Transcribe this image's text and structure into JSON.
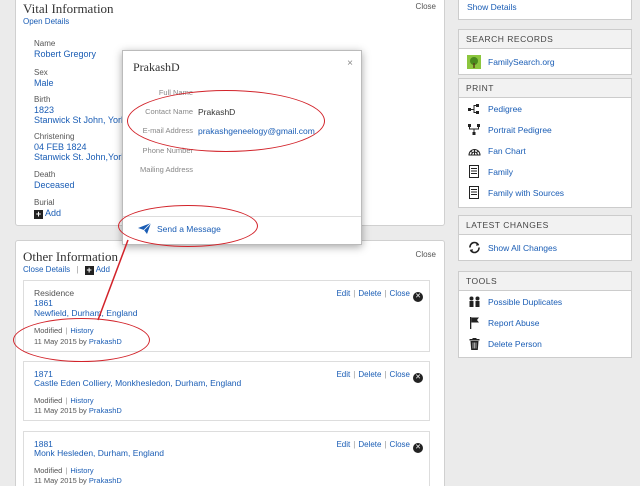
{
  "vital": {
    "title": "Vital Information",
    "close": "Close",
    "open_details": "Open Details",
    "fields": [
      {
        "label": "Name",
        "value": "Robert Gregory"
      },
      {
        "label": "Sex",
        "value": "Male"
      },
      {
        "label": "Birth",
        "value": "1823",
        "value2": "Stanwick St John, Yorks."
      },
      {
        "label": "Christening",
        "value": "04 FEB 1824",
        "value2": "Stanwick St. John,York,E"
      },
      {
        "label": "Death",
        "value": "Deceased"
      },
      {
        "label": "Burial",
        "value": "Add"
      }
    ]
  },
  "other": {
    "title": "Other Information",
    "close": "Close",
    "close_details": "Close Details",
    "add": "Add",
    "cards": [
      {
        "type": "Residence",
        "year": "1861",
        "place": "Newfield, Durham, England",
        "modified": "Modified",
        "history": "History",
        "date": "11 May 2015 by",
        "user": "PrakashD"
      },
      {
        "type": "",
        "year": "1871",
        "place": "Castle Eden Colliery, Monkhesledon, Durham, England",
        "modified": "Modified",
        "history": "History",
        "date": "11 May 2015 by",
        "user": "PrakashD"
      },
      {
        "type": "",
        "year": "1881",
        "place": "Monk Hesleden, Durham, England",
        "modified": "Modified",
        "history": "History",
        "date": "11 May 2015 by",
        "user": "PrakashD"
      }
    ],
    "edit": "Edit",
    "delete": "Delete",
    "card_close": "Close"
  },
  "modal": {
    "title": "PrakashD",
    "close_symbol": "×",
    "rows": [
      {
        "label": "Full Name",
        "value": ""
      },
      {
        "label": "Contact Name",
        "value": "PrakashD"
      },
      {
        "label": "E-mail Address",
        "value": "prakashgeneelogy@gmail.com"
      },
      {
        "label": "Phone Number",
        "value": ""
      },
      {
        "label": "Mailing Address",
        "value": ""
      }
    ],
    "send": "Send a Message"
  },
  "sidebar": {
    "top_link": "Show Details",
    "search": {
      "heading": "SEARCH RECORDS",
      "items": [
        {
          "label": "FamilySearch.org",
          "icon": "tree-icon"
        }
      ]
    },
    "print": {
      "heading": "PRINT",
      "items": [
        {
          "label": "Pedigree",
          "icon": "pedigree-icon"
        },
        {
          "label": "Portrait Pedigree",
          "icon": "portrait-pedigree-icon"
        },
        {
          "label": "Fan Chart",
          "icon": "fan-chart-icon"
        },
        {
          "label": "Family",
          "icon": "document-icon"
        },
        {
          "label": "Family with Sources",
          "icon": "document-icon"
        }
      ]
    },
    "changes": {
      "heading": "LATEST CHANGES",
      "items": [
        {
          "label": "Show All Changes",
          "icon": "refresh-icon"
        }
      ]
    },
    "tools": {
      "heading": "TOOLS",
      "items": [
        {
          "label": "Possible Duplicates",
          "icon": "people-icon"
        },
        {
          "label": "Report Abuse",
          "icon": "flag-icon"
        },
        {
          "label": "Delete Person",
          "icon": "trash-icon"
        }
      ]
    }
  },
  "colors": {
    "link": "#1a5db5",
    "annotation": "#d2232a",
    "background": "#ebebeb"
  }
}
